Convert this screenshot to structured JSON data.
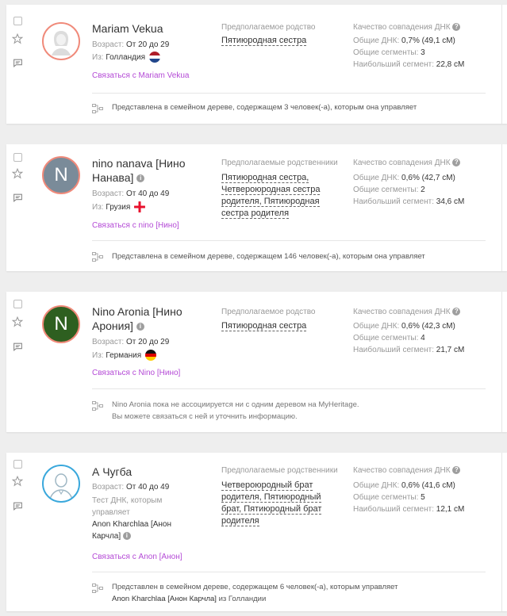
{
  "column_titles": {
    "relation_single": "Предполагаемое родство",
    "relation_plural": "Предполагаемые родственники",
    "quality": "Качество совпадения ДНК",
    "quality_icon": "help-icon"
  },
  "stat_labels": {
    "shared_dna": "Общие ДНК:",
    "segments": "Общие сегменты:",
    "largest": "Наибольший сегмент:"
  },
  "matches": [
    {
      "name": "Mariam Vekua",
      "avatar": "female-silhouette",
      "age_label": "Возраст:",
      "age": "От 20 до 29",
      "from_label": "Из:",
      "country": "Голландия",
      "flag": "netherlands",
      "contact": "Связаться с Mariam Vekua",
      "relation_title": "Предполагаемое родство",
      "relations": [
        "Пятиюродная сестра"
      ],
      "shared_dna": "0,7% (49,1 сМ)",
      "segments": "3",
      "largest": "22,8 сМ",
      "footer": "Представлена в семейном дереве, содержащем 3 человек(-а), которым она управляет"
    },
    {
      "name": "nino nanava [Нино Нанава]",
      "name_line1": "nino nanava [Нино",
      "name_line2": "Нанава]",
      "avatar_letter": "N",
      "avatar_color": "#7a8b99",
      "age_label": "Возраст:",
      "age": "От 40 до 49",
      "from_label": "Из:",
      "country": "Грузия",
      "flag": "georgia",
      "contact": "Связаться с nino [Нино]",
      "relation_title": "Предполагаемые родственники",
      "relations": [
        "Пятиюродная сестра,",
        "Четвероюродная сестра",
        "родителя, Пятиюродная",
        "сестра родителя"
      ],
      "shared_dna": "0,6% (42,7 сМ)",
      "segments": "2",
      "largest": "34,6 сМ",
      "footer": "Представлена в семейном дереве, содержащем 146 человек(-а), которым она управляет"
    },
    {
      "name": "Nino Aronia [Нино Арония]",
      "name_line1": "Nino Aronia [Нино",
      "name_line2": "Арония]",
      "avatar_letter": "N",
      "avatar_color": "#2e5f20",
      "age_label": "Возраст:",
      "age": "От 20 до 29",
      "from_label": "Из:",
      "country": "Германия",
      "flag": "germany",
      "contact": "Связаться с Nino [Нино]",
      "relation_title": "Предполагаемое родство",
      "relations": [
        "Пятиюродная сестра"
      ],
      "shared_dna": "0,6% (42,3 сМ)",
      "segments": "4",
      "largest": "21,7 сМ",
      "footer_line1": "Nino Aronia пока не ассоциируется ни с одним деревом на MyHeritage.",
      "footer_line2": "Вы можете связаться с ней и уточнить информацию."
    },
    {
      "name": "А Чугба",
      "avatar": "male-silhouette",
      "age_label": "Возраст:",
      "age": "От 40 до 49",
      "managed_line1": "Тест ДНК, которым",
      "managed_line2": "управляет",
      "manager_line1": "Anon Kharchlaa [Анон",
      "manager_line2": "Карчла]",
      "contact": "Связаться с Anon [Анон]",
      "relation_title": "Предполагаемые родственники",
      "relations": [
        "Четвероюродный брат",
        "родителя, Пятиюродный",
        "брат, Пятиюродный брат",
        "родителя"
      ],
      "shared_dna": "0,6% (41,6 сМ)",
      "segments": "5",
      "largest": "12,1 сМ",
      "footer_line1": "Представлен в семейном дереве, содержащем 6 человек(-а), которым управляет",
      "footer_line2_bold": "Anon Kharchlaa [Анон Карчла]",
      "footer_line2_rest": " из Голландии"
    }
  ],
  "colors": {
    "link": "#b44ad6",
    "avatar_border": "#f08a7a",
    "avatar_border_blue": "#3aa8dc"
  }
}
